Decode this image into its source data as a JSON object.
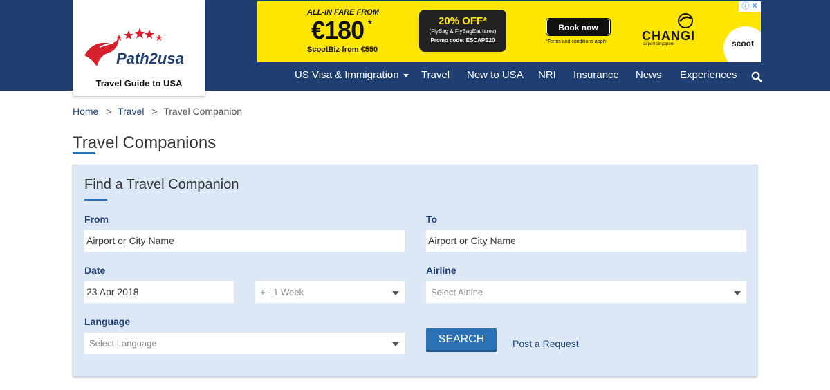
{
  "header": {
    "logo_text": "Path2usa",
    "tagline": "Travel Guide to USA",
    "nav": [
      {
        "label": "US Visa & Immigration",
        "has_caret": true
      },
      {
        "label": "Travel"
      },
      {
        "label": "New to USA"
      },
      {
        "label": "NRI"
      },
      {
        "label": "Insurance"
      },
      {
        "label": "News"
      },
      {
        "label": "Experiences"
      }
    ],
    "search_icon": "search-icon"
  },
  "ad": {
    "fare_label": "ALL-IN FARE FROM",
    "price": "€180",
    "price_sup": "*",
    "biz": "ScootBiz from €550",
    "offer_title": "20% OFF*",
    "offer_sub": "(FlyBag & FlyBagEat fares)",
    "offer_promo": "Promo code: ESCAPE20",
    "book": "Book now",
    "terms": "*Terms and conditions apply.",
    "changi": "CHANGI",
    "changi_sub": "airport singapore",
    "scoot": "scoot",
    "info": "ⓘ ✕"
  },
  "breadcrumb": {
    "items": [
      "Home",
      "Travel",
      "Travel Companion"
    ],
    "separator": ">"
  },
  "page_title": "Travel Companions",
  "panel": {
    "title": "Find a Travel Companion",
    "from_label": "From",
    "from_placeholder": "Airport or City Name",
    "to_label": "To",
    "to_placeholder": "Airport or City Name",
    "date_label": "Date",
    "date_value": "23 Apr 2018",
    "range_value": "+ - 1 Week",
    "airline_label": "Airline",
    "airline_value": "Select Airline",
    "language_label": "Language",
    "language_value": "Select Language",
    "search_button": "SEARCH",
    "post_link": "Post a Request"
  },
  "colors": {
    "header_bg": "#1f3f73",
    "panel_bg": "#dce8f6",
    "accent": "#2a72b5",
    "ad_bg": "#ffe600"
  }
}
